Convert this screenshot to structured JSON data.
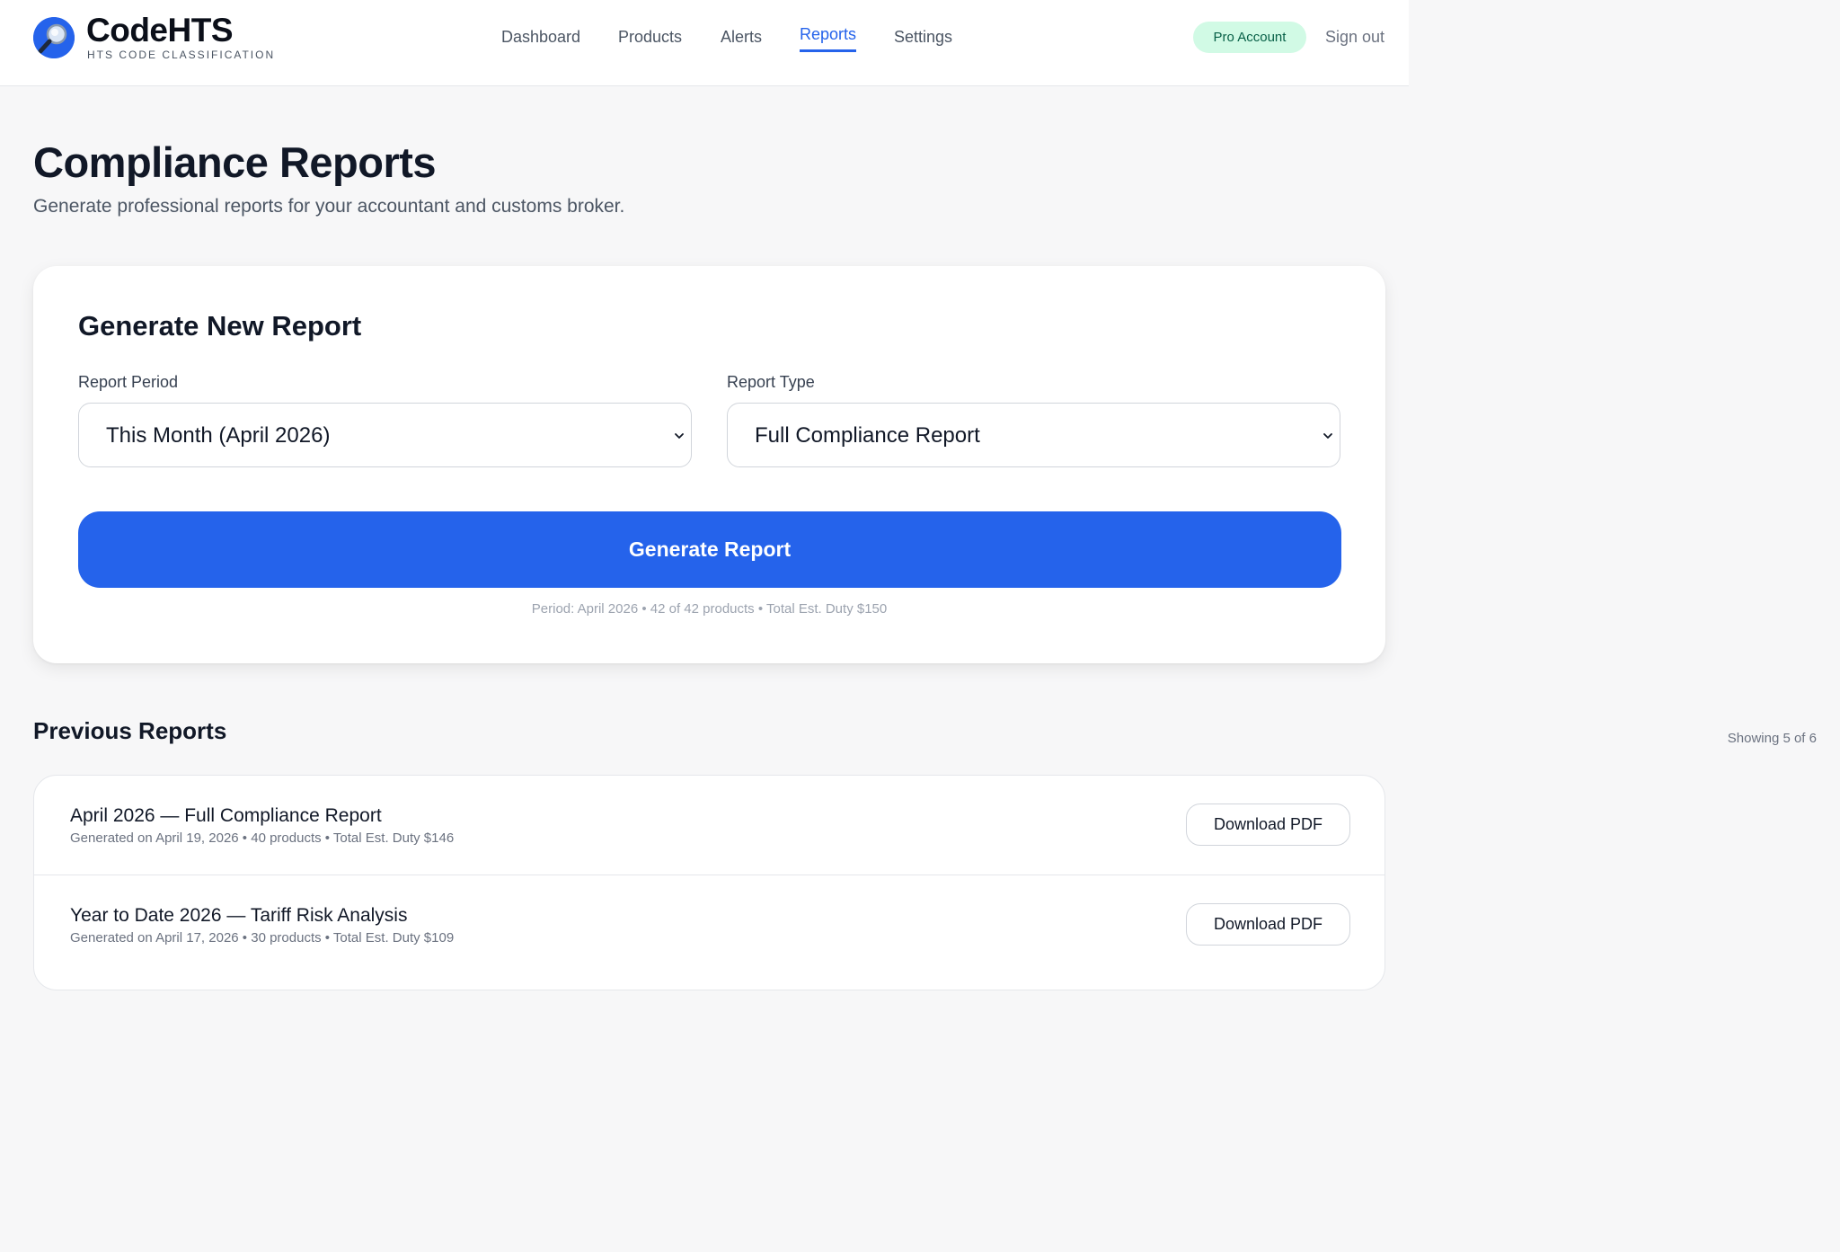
{
  "brand": {
    "name": "CodeHTS",
    "tagline": "HTS CODE CLASSIFICATION",
    "logo_icon": "magnifier-icon"
  },
  "nav": {
    "items": [
      {
        "label": "Dashboard",
        "active": false
      },
      {
        "label": "Products",
        "active": false
      },
      {
        "label": "Alerts",
        "active": false
      },
      {
        "label": "Reports",
        "active": true
      },
      {
        "label": "Settings",
        "active": false
      }
    ],
    "account_badge": "Pro Account",
    "sign_out": "Sign out"
  },
  "page": {
    "title": "Compliance Reports",
    "subtitle": "Generate professional reports for your accountant and customs broker."
  },
  "generator": {
    "title": "Generate New Report",
    "period_label": "Report Period",
    "period_value": "This Month (April 2026)",
    "type_label": "Report Type",
    "type_value": "Full Compliance Report",
    "button_label": "Generate Report",
    "summary": "Period: April 2026 • 42 of 42 products • Total Est. Duty $150"
  },
  "previous": {
    "title": "Previous Reports",
    "count_text": "Showing 5 of 6",
    "reports": [
      {
        "name": "April 2026 — Full Compliance Report",
        "meta": "Generated on April 19, 2026 • 40 products • Total Est. Duty $146",
        "action": "Download PDF"
      },
      {
        "name": "Year to Date 2026 — Tariff Risk Analysis",
        "meta": "Generated on April 17, 2026 • 30 products • Total Est. Duty $109",
        "action": "Download PDF"
      }
    ]
  },
  "colors": {
    "accent": "#2563eb",
    "badge_bg": "#d1fae5",
    "badge_text": "#065f46",
    "page_bg": "#f7f7f8"
  }
}
